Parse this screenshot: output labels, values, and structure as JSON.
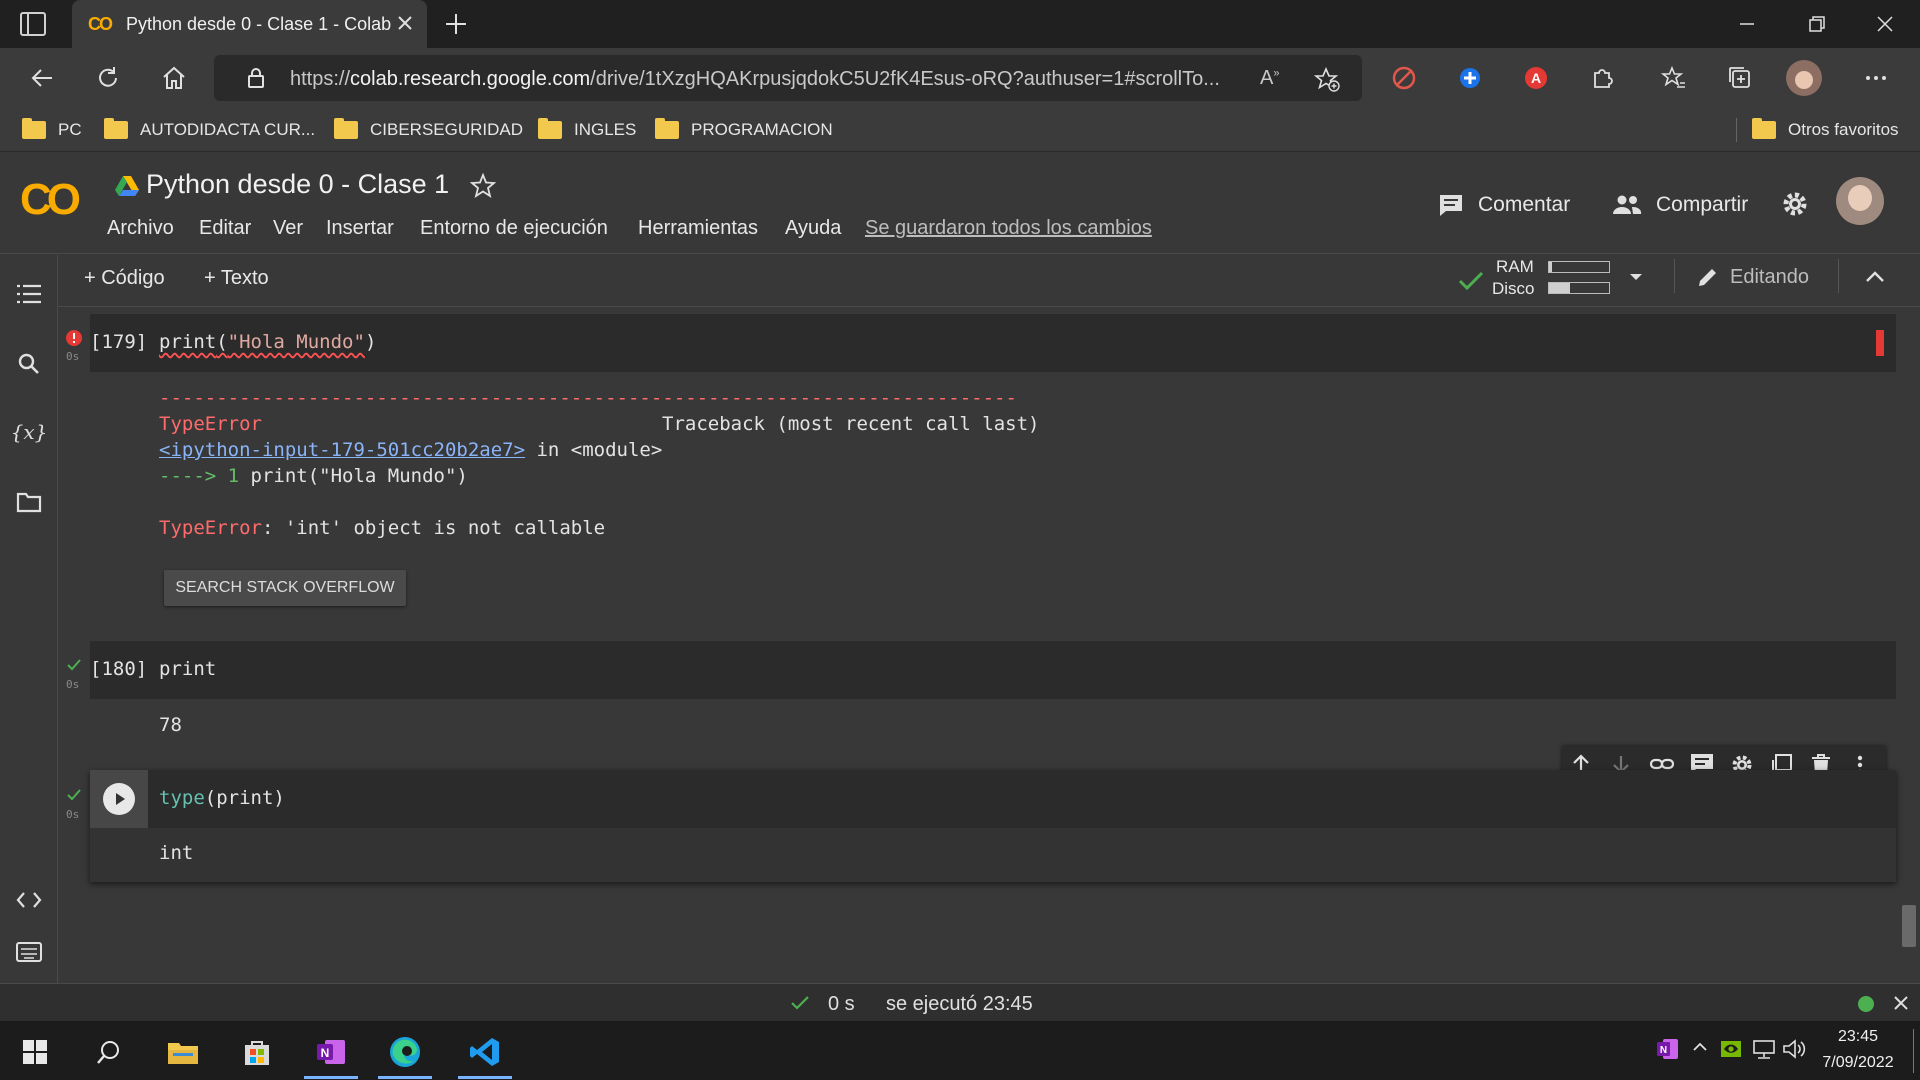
{
  "browser": {
    "tab_title": "Python desde 0 - Clase 1 - Colab",
    "url_prefix": "https://",
    "url_domain": "colab.research.google.com",
    "url_path": "/drive/1tXzgHQAKrpusjqdokC5U2fK4Esus-oRQ?authuser=1#scrollTo...",
    "read_aloud_label": "A⁰"
  },
  "bookmarks": [
    {
      "label": "PC"
    },
    {
      "label": "AUTODIDACTA CUR..."
    },
    {
      "label": "CIBERSEGURIDAD"
    },
    {
      "label": "INGLES"
    },
    {
      "label": "PROGRAMACION"
    }
  ],
  "bookmarks_other": "Otros favoritos",
  "colab": {
    "logo": "CO",
    "title": "Python desde 0 - Clase 1",
    "menu": [
      "Archivo",
      "Editar",
      "Ver",
      "Insertar",
      "Entorno de ejecución",
      "Herramientas",
      "Ayuda"
    ],
    "saved_status": "Se guardaron todos los cambios",
    "comment_label": "Comentar",
    "share_label": "Compartir"
  },
  "toolbar": {
    "add_code": "+ Código",
    "add_text": "+ Texto",
    "ram_label": "RAM",
    "disk_label": "Disco",
    "ram_usage": 0.05,
    "disk_usage": 0.35,
    "editing_label": "Editando"
  },
  "cells": {
    "c1": {
      "prompt": "[179]",
      "time": "0s",
      "code_fn": "print",
      "code_open": "(",
      "code_str": "\"Hola Mundo\"",
      "code_close": ")",
      "divider": "---------------------------------------------------------------------------",
      "err_type": "TypeError",
      "traceback": "Traceback (most recent call last)",
      "link": "<ipython-input-179-501cc20b2ae7>",
      "in_module": " in <module>",
      "arrow": "----> 1 ",
      "arrow_code": "print(\"Hola Mundo\")",
      "err_name": "TypeError",
      "err_msg": ": 'int' object is not callable",
      "so_button": "SEARCH STACK OVERFLOW"
    },
    "c2": {
      "prompt": "[180]",
      "time": "0s",
      "code": "print",
      "output": "78"
    },
    "c3": {
      "time": "0s",
      "code_fn": "type",
      "code_rest": "(print)",
      "output": "int"
    }
  },
  "statusbar": {
    "duration": "0 s",
    "executed": "se ejecutó 23:45"
  },
  "taskbar": {
    "time": "23:45",
    "date": "7/09/2022"
  },
  "colors": {
    "accent_orange": "#f9ab00",
    "error_red": "#ff6b6b",
    "success_green": "#4caf50",
    "link_blue": "#8ab4f8"
  }
}
